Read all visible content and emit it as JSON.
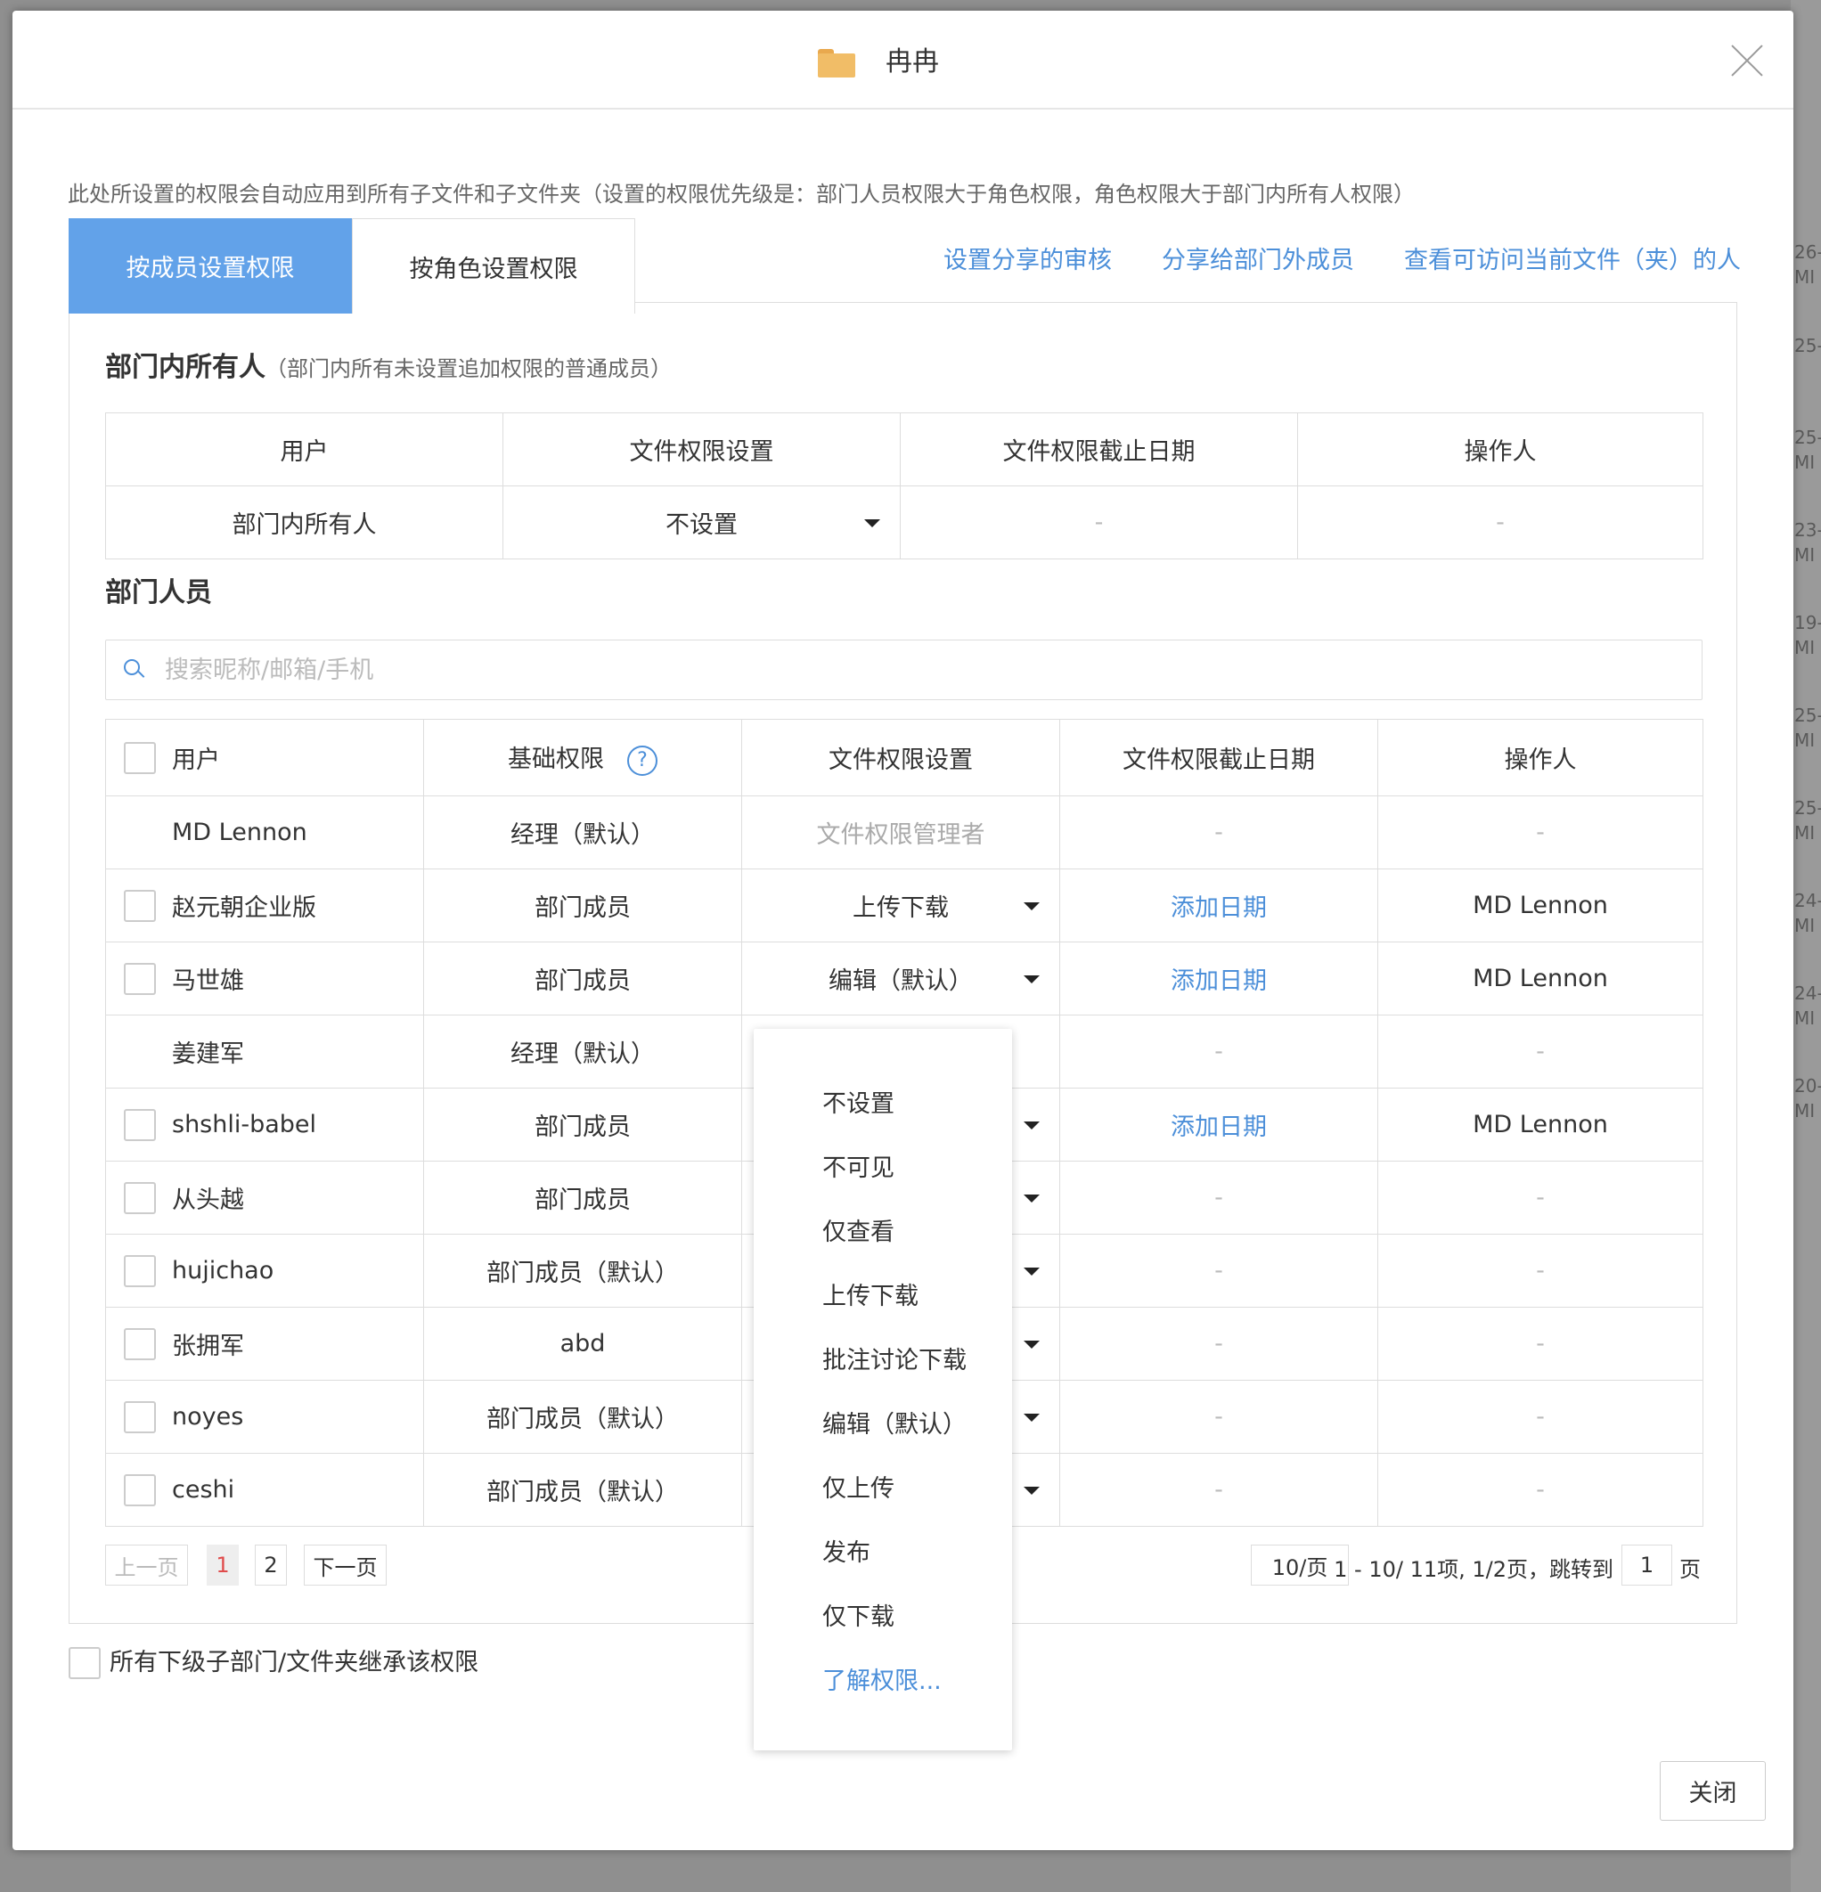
{
  "bg_right_labels": [
    "26-",
    "MI",
    "25-",
    "25-",
    "MI",
    "23-",
    "MI",
    "19-",
    "MI",
    "25-",
    "MI",
    "25-",
    "MI",
    "24-",
    "MI",
    "24-",
    "MI",
    "20-",
    "MI"
  ],
  "dialog": {
    "title": "冉冉",
    "icons": {
      "folder": "folder-icon",
      "close": "close-icon"
    },
    "notice": "此处所设置的权限会自动应用到所有子文件和子文件夹（设置的权限优先级是：部门人员权限大于角色权限，角色权限大于部门内所有人权限）",
    "tabs": [
      {
        "label": "按成员设置权限",
        "active": true
      },
      {
        "label": "按角色设置权限",
        "active": false
      }
    ],
    "links": [
      "设置分享的审核",
      "分享给部门外成员",
      "查看可访问当前文件（夹）的人"
    ],
    "all_members_section": {
      "title": "部门内所有人",
      "subtitle": "（部门内所有未设置追加权限的普通成员）",
      "headers": [
        "用户",
        "文件权限设置",
        "文件权限截止日期",
        "操作人"
      ],
      "row": {
        "user": "部门内所有人",
        "permission": "不设置",
        "deadline": "-",
        "operator": "-"
      }
    },
    "members_section": {
      "title": "部门人员",
      "search_placeholder": "搜索昵称/邮箱/手机",
      "headers": [
        "用户",
        "基础权限",
        "文件权限设置",
        "文件权限截止日期",
        "操作人"
      ],
      "rows": [
        {
          "user": "MD Lennon",
          "base": "经理（默认）",
          "perm": "文件权限管理者",
          "deadline": "-",
          "operator": "-"
        },
        {
          "user": "赵元朝企业版",
          "base": "部门成员",
          "perm": "上传下载",
          "deadline": "添加日期",
          "operator": "MD Lennon"
        },
        {
          "user": "马世雄",
          "base": "部门成员",
          "perm": "编辑（默认）",
          "deadline": "添加日期",
          "operator": "MD Lennon"
        },
        {
          "user": "姜建军",
          "base": "经理（默认）",
          "perm": "",
          "deadline": "-",
          "operator": "-"
        },
        {
          "user": "shshli-babel",
          "base": "部门成员",
          "perm": "",
          "deadline": "添加日期",
          "operator": "MD Lennon"
        },
        {
          "user": "从头越",
          "base": "部门成员",
          "perm": "",
          "deadline": "-",
          "operator": "-"
        },
        {
          "user": "hujichao",
          "base": "部门成员（默认）",
          "perm": "",
          "deadline": "-",
          "operator": "-"
        },
        {
          "user": "张拥军",
          "base": "abd",
          "perm": "",
          "deadline": "-",
          "operator": "-"
        },
        {
          "user": "noyes",
          "base": "部门成员（默认）",
          "perm": "",
          "deadline": "-",
          "operator": "-"
        },
        {
          "user": "ceshi",
          "base": "部门成员（默认）",
          "perm": "",
          "deadline": "-",
          "operator": "-"
        }
      ]
    },
    "pagination": {
      "prev": "上一页",
      "pages": [
        "1",
        "2"
      ],
      "current": "1",
      "next": "下一页",
      "page_size": "10/页",
      "summary": "1 - 10/ 11项, 1/2页，跳转到",
      "jump_value": "1",
      "jump_suffix": "页"
    },
    "inherit_label": "所有下级子部门/文件夹继承该权限",
    "close_button": "关闭",
    "dropdown_options": [
      "不设置",
      "不可见",
      "仅查看",
      "上传下载",
      "批注讨论下载",
      "编辑（默认）",
      "仅上传",
      "发布",
      "仅下载"
    ],
    "dropdown_link": "了解权限..."
  },
  "colors": {
    "accent": "#62a2e9",
    "link": "#4c8fd9",
    "current_page": "#e04b4b"
  }
}
